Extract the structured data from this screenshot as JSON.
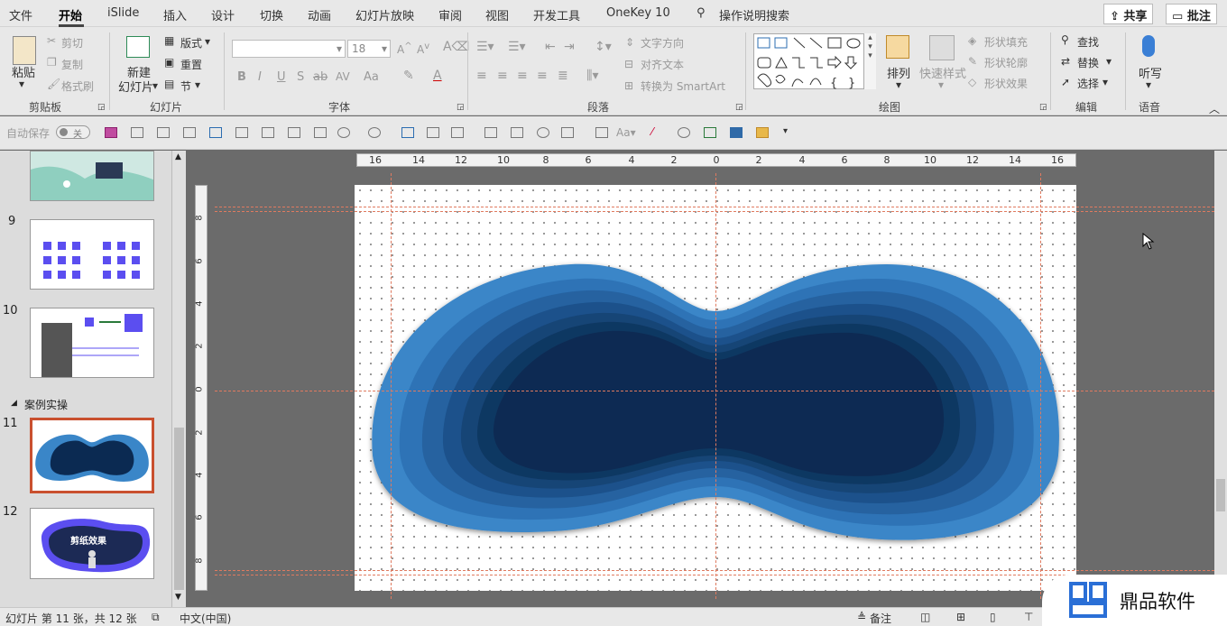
{
  "menu": {
    "items": [
      "文件",
      "开始",
      "iSlide",
      "插入",
      "设计",
      "切换",
      "动画",
      "幻灯片放映",
      "审阅",
      "视图",
      "开发工具",
      "OneKey 10"
    ],
    "search": "操作说明搜索",
    "share": "共享",
    "comment": "批注"
  },
  "ribbon": {
    "clipboard": {
      "label": "剪贴板",
      "paste": "粘贴",
      "cut": "剪切",
      "copy": "复制",
      "format_painter": "格式刷"
    },
    "slides": {
      "label": "幻灯片",
      "new_slide": "新建",
      "new_slide2": "幻灯片",
      "layout": "版式",
      "reset": "重置",
      "section": "节"
    },
    "font": {
      "label": "字体",
      "size": "18",
      "bold": "B",
      "italic": "I",
      "underline": "U",
      "shadow": "S",
      "strike": "ab",
      "spacing": "AV",
      "case": "Aa"
    },
    "paragraph": {
      "label": "段落",
      "text_direction": "文字方向",
      "align_text": "对齐文本",
      "smartart": "转换为 SmartArt"
    },
    "drawing": {
      "label": "绘图",
      "arrange": "排列",
      "quick_styles": "快速样式",
      "shape_fill": "形状填充",
      "shape_outline": "形状轮廓",
      "shape_effects": "形状效果"
    },
    "editing": {
      "label": "编辑",
      "find": "查找",
      "replace": "替换",
      "select": "选择"
    },
    "voice": {
      "label": "语音",
      "dictate": "听写"
    }
  },
  "qat": {
    "autosave": "自动保存",
    "autosave_state": "关"
  },
  "thumbnails": [
    {
      "num": "9"
    },
    {
      "num": "10"
    },
    {
      "num": "11"
    },
    {
      "num": "12",
      "text": "剪纸效果"
    }
  ],
  "section": "案例实操",
  "ruler": {
    "h": [
      "16",
      "14",
      "12",
      "10",
      "8",
      "6",
      "4",
      "2",
      "0",
      "2",
      "4",
      "6",
      "8",
      "10",
      "12",
      "14",
      "16"
    ],
    "v": [
      "8",
      "6",
      "4",
      "2",
      "0",
      "2",
      "4",
      "6",
      "8"
    ]
  },
  "status": {
    "slide_info": "幻灯片 第 11 张，共 12 张",
    "language": "中文(中国)",
    "notes": "备注"
  },
  "watermark": "鼎品软件",
  "colors": {
    "ribbon": "#e8e8e8",
    "slide_bg": "#ffffff",
    "shape_outer": "#3a86c8",
    "shape_inner": "#0b2a52",
    "guide": "#e07a5f",
    "selection": "#c9502f"
  }
}
